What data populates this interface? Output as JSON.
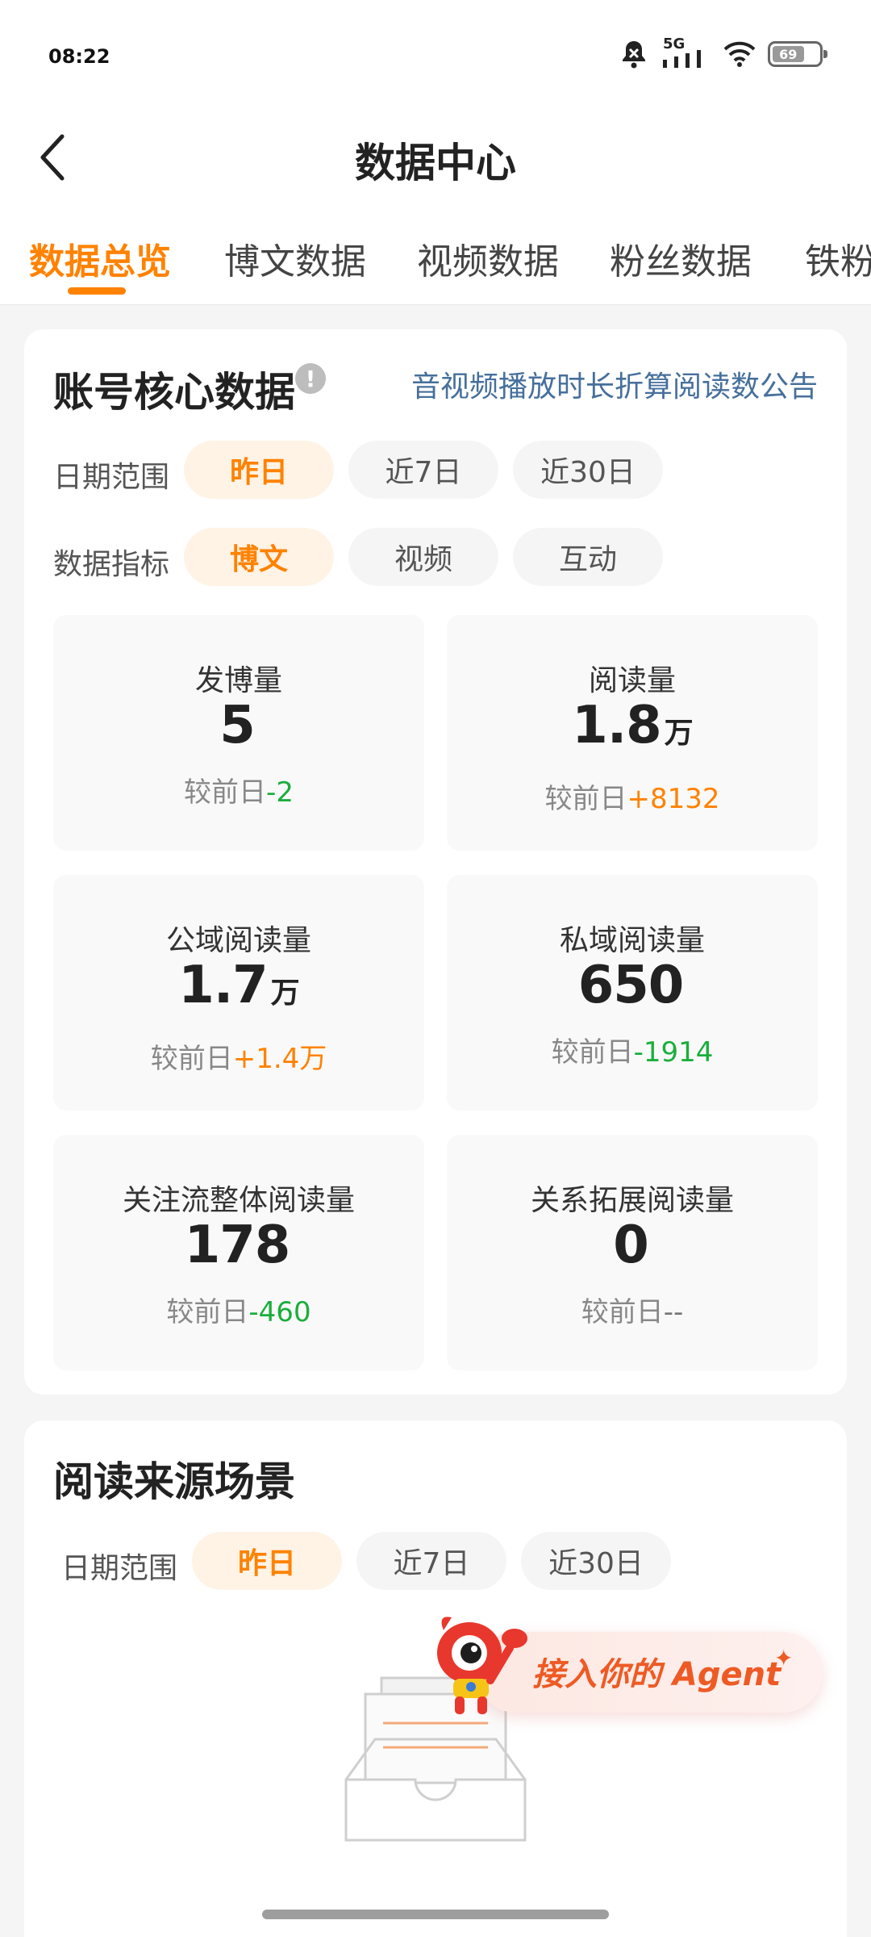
{
  "status_bar": {
    "time": "08:22",
    "network": "5G",
    "battery": "69"
  },
  "header": {
    "title": "数据中心"
  },
  "tabs": [
    {
      "label": "数据总览",
      "active": true
    },
    {
      "label": "博文数据",
      "active": false
    },
    {
      "label": "视频数据",
      "active": false
    },
    {
      "label": "粉丝数据",
      "active": false
    },
    {
      "label": "铁粉",
      "active": false
    }
  ],
  "core": {
    "title": "账号核心数据",
    "info_icon": "!",
    "notice_link": "音视频播放时长折算阅读数公告",
    "date_range": {
      "label": "日期范围",
      "options": [
        "昨日",
        "近7日",
        "近30日"
      ],
      "selected": "昨日"
    },
    "metric": {
      "label": "数据指标",
      "options": [
        "博文",
        "视频",
        "互动"
      ],
      "selected": "博文"
    },
    "compare_prefix": "较前日",
    "stats": [
      {
        "label": "发博量",
        "value": "5",
        "unit": "",
        "delta": "-2"
      },
      {
        "label": "阅读量",
        "value": "1.8",
        "unit": "万",
        "delta": "+8132"
      },
      {
        "label": "公域阅读量",
        "value": "1.7",
        "unit": "万",
        "delta": "+1.4万"
      },
      {
        "label": "私域阅读量",
        "value": "650",
        "unit": "",
        "delta": "-1914"
      },
      {
        "label": "关注流整体阅读量",
        "value": "178",
        "unit": "",
        "delta": "-460"
      },
      {
        "label": "关系拓展阅读量",
        "value": "0",
        "unit": "",
        "delta": "--"
      }
    ]
  },
  "sources": {
    "title": "阅读来源场景",
    "date_range": {
      "label": "日期范围",
      "options": [
        "昨日",
        "近7日",
        "近30日"
      ],
      "selected": "昨日"
    }
  },
  "agent_button": {
    "label": "接入你的 Agent"
  },
  "colors": {
    "accent": "#ff8200",
    "positive": "#ff8200",
    "negative": "#1aae3b",
    "link": "#466f9c"
  }
}
